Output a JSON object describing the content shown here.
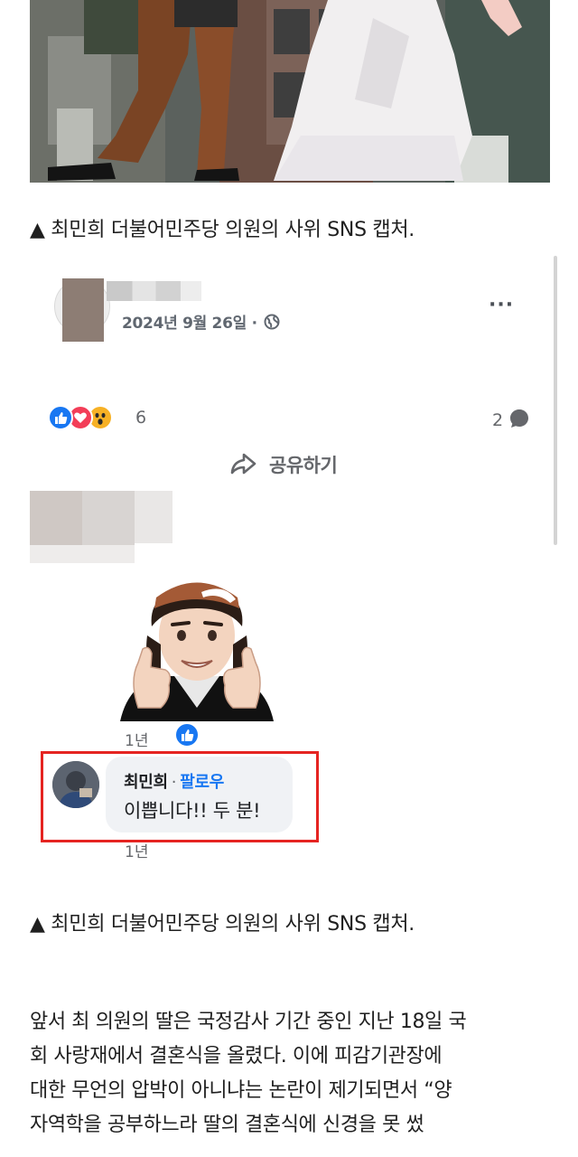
{
  "photo": {
    "alt": "wedding photo - couple walking"
  },
  "captions": {
    "first": "▲ 최민희 더불어민주당 의원의 사위 SNS 캡처.",
    "second": "▲ 최민희 더불어민주당 의원의 사위 SNS 캡처."
  },
  "post": {
    "date": "2024년 9월 26일 ·",
    "more": "···",
    "reaction_count": "6",
    "comment_count": "2",
    "share_label": "공유하기",
    "sticker_time": "1년",
    "comment": {
      "author": "최민희",
      "separator": "·",
      "follow_label": "팔로우",
      "text": "이쁩니다!! 두 분!",
      "time": "1년"
    }
  },
  "article": {
    "lines": [
      "앞서 최 의원의 딸은 국정감사 기간 중인 지난 18일 국",
      "회 사랑재에서 결혼식을 올렸다.  이에 피감기관장에",
      "대한 무언의 압박이 아니냐는 논란이 제기되면서 “양",
      "자역학을 공부하느라 딸의 결혼식에 신경을 못 썼"
    ]
  },
  "colors": {
    "facebook_blue": "#1877f2",
    "highlight_red": "#e52421",
    "love_red": "#f33e58",
    "wow_yellow": "#f7b125"
  }
}
